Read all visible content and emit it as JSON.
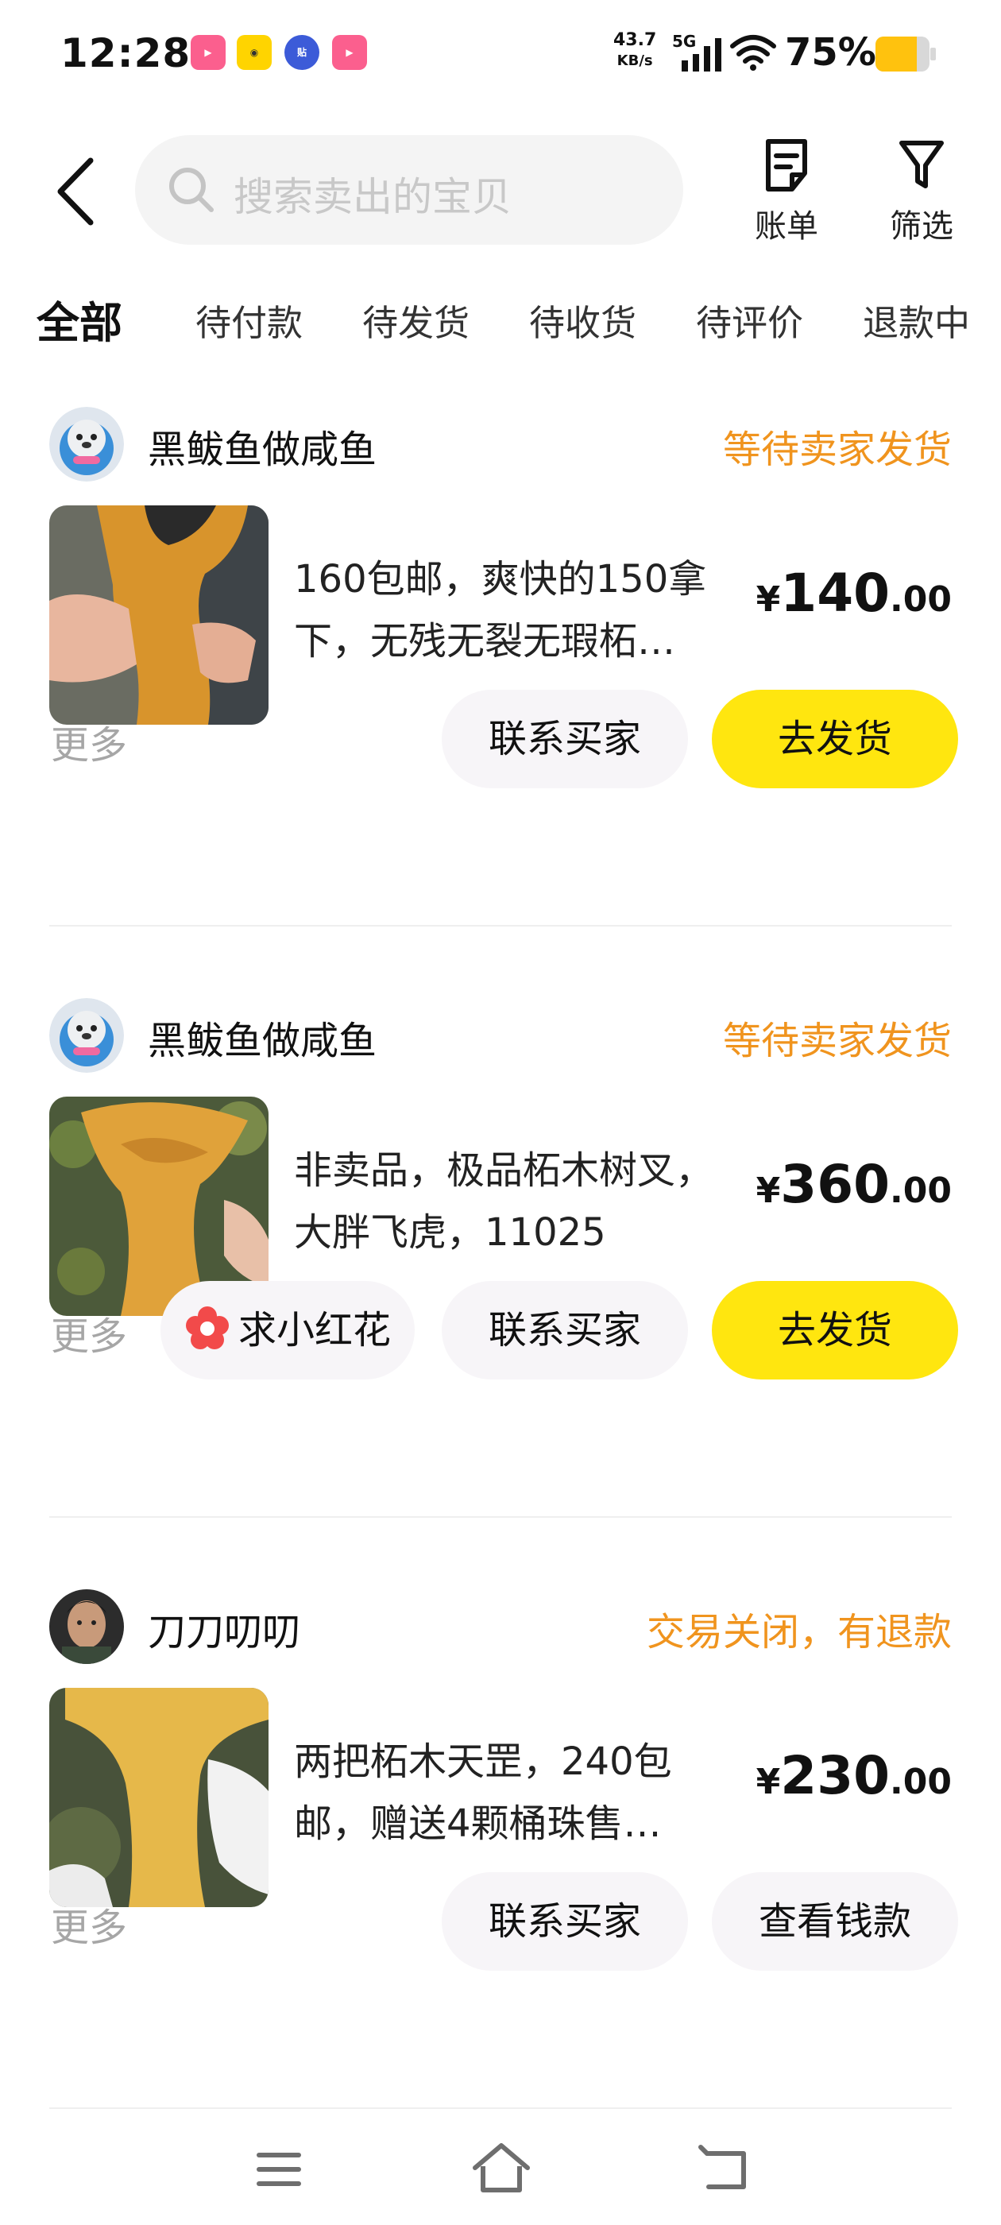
{
  "status_bar": {
    "time": "12:28",
    "net_speed_top": "43.7",
    "net_speed_bottom": "KB/s",
    "network": "5G",
    "battery": "75%",
    "app_badges": [
      "bilibili",
      "啊嗯",
      "贴",
      "bilibili"
    ]
  },
  "header": {
    "search_placeholder": "搜索卖出的宝贝",
    "bill_label": "账单",
    "filter_label": "筛选"
  },
  "tabs": [
    {
      "label": "全部",
      "active": true
    },
    {
      "label": "待付款"
    },
    {
      "label": "待发货"
    },
    {
      "label": "待收货"
    },
    {
      "label": "待评价"
    },
    {
      "label": "退款中"
    }
  ],
  "orders": [
    {
      "seller": "黑鲅鱼做咸鱼",
      "status": "等待卖家发货",
      "title": "160包邮，爽快的150拿下，无残无裂无瑕柘…",
      "price_symbol": "¥",
      "price_int": "140",
      "price_dec": ".00",
      "more": "更多",
      "buttons": [
        "联系买家",
        "去发货"
      ]
    },
    {
      "seller": "黑鲅鱼做咸鱼",
      "status": "等待卖家发货",
      "title": "非卖品，极品柘木树叉，大胖飞虎，11025",
      "price_symbol": "¥",
      "price_int": "360",
      "price_dec": ".00",
      "more": "更多",
      "buttons": [
        "求小红花",
        "联系买家",
        "去发货"
      ]
    },
    {
      "seller": "刀刀叨叨",
      "status": "交易关闭，有退款",
      "title": "两把柘木天罡，240包邮，赠送4颗桶珠售…",
      "price_symbol": "¥",
      "price_int": "230",
      "price_dec": ".00",
      "more": "更多",
      "buttons": [
        "联系买家",
        "查看钱款"
      ]
    }
  ],
  "colors": {
    "accent_yellow": "#ffe60f",
    "status_orange": "#f0941e",
    "muted_text": "#a6a6a6"
  },
  "icons": {
    "back": "chevron-left-icon",
    "search": "search-icon",
    "bill": "bill-icon",
    "filter": "funnel-icon",
    "flower": "flower-icon",
    "nav_menu": "menu-icon",
    "nav_home": "home-icon",
    "nav_back": "back-arrow-icon"
  }
}
